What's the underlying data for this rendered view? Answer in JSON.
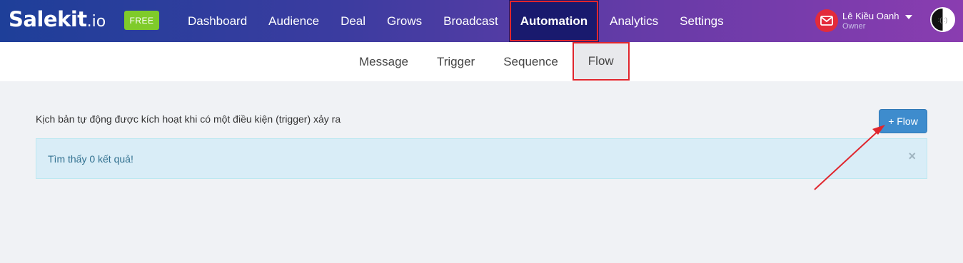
{
  "brand": {
    "logo_main": "Salekit",
    "logo_suffix": ".io",
    "plan_badge": "FREE"
  },
  "nav": {
    "items": [
      {
        "label": "Dashboard"
      },
      {
        "label": "Audience"
      },
      {
        "label": "Deal"
      },
      {
        "label": "Grows"
      },
      {
        "label": "Broadcast"
      },
      {
        "label": "Automation",
        "active": true
      },
      {
        "label": "Analytics"
      },
      {
        "label": "Settings"
      }
    ]
  },
  "user": {
    "name": "Lê Kiều Oanh",
    "role": "Owner",
    "avatar_text": ":( :)"
  },
  "subnav": {
    "items": [
      {
        "label": "Message"
      },
      {
        "label": "Trigger"
      },
      {
        "label": "Sequence"
      },
      {
        "label": "Flow",
        "active": true
      }
    ]
  },
  "main": {
    "description": "Kịch bản tự động được kích hoạt khi có một điều kiện (trigger) xảy ra",
    "add_flow_label": "+ Flow",
    "alert_text": "Tìm thấy 0 kết quả!",
    "alert_close": "×"
  },
  "colors": {
    "topbar_start": "#1e3f99",
    "topbar_end": "#8a3db0",
    "active_nav": "#191a6e",
    "highlight": "#e0262d",
    "primary_button": "#3e8ccd",
    "free_badge": "#7fcb2a",
    "alert_bg": "#d9edf7"
  },
  "icons": [
    "mail-icon",
    "caret-down-icon",
    "close-icon",
    "annotation-arrow"
  ]
}
